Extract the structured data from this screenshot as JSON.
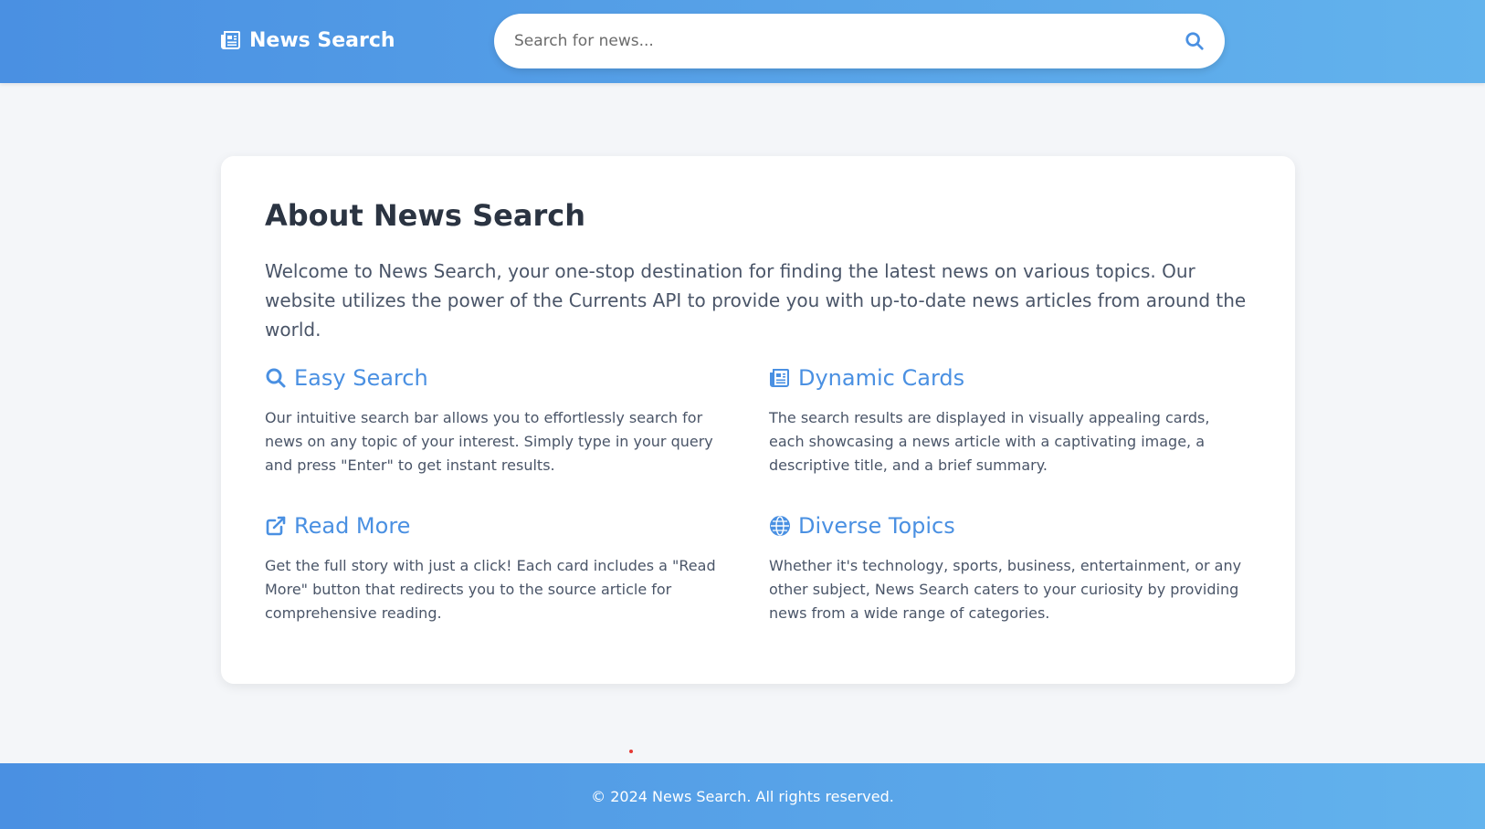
{
  "header": {
    "brand_name": "News Search",
    "brand_icon": "newspaper-icon",
    "search_placeholder": "Search for news...",
    "search_value": "",
    "search_icon": "search-icon"
  },
  "about": {
    "title": "About News Search",
    "intro": "Welcome to News Search, your one-stop destination for finding the latest news on various topics. Our website utilizes the power of the Currents API to provide you with up-to-date news articles from around the world.",
    "features": [
      {
        "icon": "search-icon",
        "title": "Easy Search",
        "text": "Our intuitive search bar allows you to effortlessly search for news on any topic of your interest. Simply type in your query and press \"Enter\" to get instant results."
      },
      {
        "icon": "newspaper-icon",
        "title": "Dynamic Cards",
        "text": "The search results are displayed in visually appealing cards, each showcasing a news article with a captivating image, a descriptive title, and a brief summary."
      },
      {
        "icon": "external-link-icon",
        "title": "Read More",
        "text": "Get the full story with just a click! Each card includes a \"Read More\" button that redirects you to the source article for comprehensive reading."
      },
      {
        "icon": "globe-icon",
        "title": "Diverse Topics",
        "text": "Whether it's technology, sports, business, entertainment, or any other subject, News Search caters to your curiosity by providing news from a wide range of categories."
      }
    ]
  },
  "footer": {
    "copyright": "© 2024 News Search. All rights reserved."
  },
  "colors": {
    "accent": "#4a90e2",
    "accent_light": "#63b3ed",
    "background": "#f4f6f9",
    "card": "#ffffff",
    "heading": "#2b3442",
    "body_text": "#4a5568"
  }
}
